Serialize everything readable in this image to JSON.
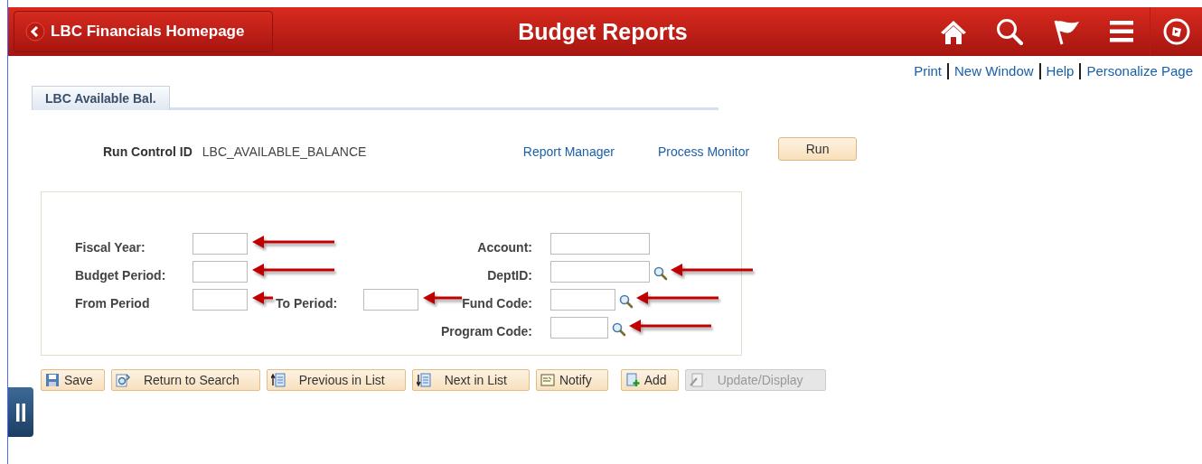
{
  "header": {
    "back_button": "LBC Financials Homepage",
    "title": "Budget Reports"
  },
  "page_links": [
    "Print",
    "New Window",
    "Help",
    "Personalize Page"
  ],
  "tabs": [
    {
      "label": "LBC Available Bal.",
      "selected": true
    }
  ],
  "run_control": {
    "label": "Run Control ID",
    "value": "LBC_AVAILABLE_BALANCE",
    "links": [
      "Report Manager",
      "Process Monitor"
    ],
    "run_button": "Run"
  },
  "form": {
    "rows": [
      {
        "left": [
          {
            "label": "Fiscal Year:",
            "annotated": true
          }
        ],
        "right": {
          "label": "Account:",
          "lookup": false,
          "annotated": false
        }
      },
      {
        "left": [
          {
            "label": "Budget Period:",
            "annotated": true
          }
        ],
        "right": {
          "label": "DeptID:",
          "lookup": true,
          "annotated": true
        }
      },
      {
        "left": [
          {
            "label": "From Period",
            "annotated": true
          },
          {
            "label": "To Period:",
            "annotated": true
          }
        ],
        "right": {
          "label": "Fund Code:",
          "lookup": true,
          "annotated": true
        }
      },
      {
        "left": [],
        "right": {
          "label": "Program Code:",
          "lookup": true,
          "annotated": true
        }
      }
    ]
  },
  "toolbar": [
    {
      "label": "Save",
      "kind": "save",
      "disabled": false
    },
    {
      "label": "Return to Search",
      "kind": "return",
      "disabled": false
    },
    {
      "label": "Previous in List",
      "kind": "previous",
      "disabled": false
    },
    {
      "label": "Next in List",
      "kind": "next",
      "disabled": false
    },
    {
      "label": "Notify",
      "kind": "notify",
      "disabled": false
    },
    {
      "label": "Add",
      "kind": "add",
      "disabled": false
    },
    {
      "label": "Update/Display",
      "kind": "update",
      "disabled": true
    }
  ]
}
